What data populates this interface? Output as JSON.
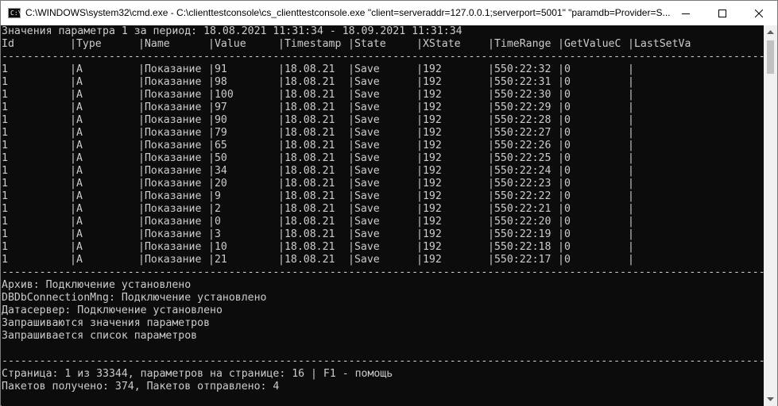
{
  "window": {
    "title": "C:\\WINDOWS\\system32\\cmd.exe - C:\\clienttestconsole\\cs_clienttestconsole.exe  \"client=serveraddr=127.0.0.1;serverport=5001\" \"paramdb=Provider=S..."
  },
  "console": {
    "heading": "Значения параметра 1 за период: 18.08.2021 11:31:34 - 18.09.2021 11:31:34",
    "columns": [
      "Id",
      "|Type",
      "|Name",
      "|Value",
      "|Timestamp",
      "|State",
      "|XState",
      "|TimeRange",
      "|GetValueC",
      "|LastSetVa"
    ],
    "separator": "--------------------------------------------------------------------------------------------------------------------------------",
    "rows": [
      [
        "1",
        "|A",
        "|Показание",
        "|91",
        "|18.08.21",
        "|Save",
        "|192",
        "|550:22:32",
        "|0",
        "|"
      ],
      [
        "1",
        "|A",
        "|Показание",
        "|98",
        "|18.08.21",
        "|Save",
        "|192",
        "|550:22:31",
        "|0",
        "|"
      ],
      [
        "1",
        "|A",
        "|Показание",
        "|100",
        "|18.08.21",
        "|Save",
        "|192",
        "|550:22:30",
        "|0",
        "|"
      ],
      [
        "1",
        "|A",
        "|Показание",
        "|97",
        "|18.08.21",
        "|Save",
        "|192",
        "|550:22:29",
        "|0",
        "|"
      ],
      [
        "1",
        "|A",
        "|Показание",
        "|90",
        "|18.08.21",
        "|Save",
        "|192",
        "|550:22:28",
        "|0",
        "|"
      ],
      [
        "1",
        "|A",
        "|Показание",
        "|79",
        "|18.08.21",
        "|Save",
        "|192",
        "|550:22:27",
        "|0",
        "|"
      ],
      [
        "1",
        "|A",
        "|Показание",
        "|65",
        "|18.08.21",
        "|Save",
        "|192",
        "|550:22:26",
        "|0",
        "|"
      ],
      [
        "1",
        "|A",
        "|Показание",
        "|50",
        "|18.08.21",
        "|Save",
        "|192",
        "|550:22:25",
        "|0",
        "|"
      ],
      [
        "1",
        "|A",
        "|Показание",
        "|34",
        "|18.08.21",
        "|Save",
        "|192",
        "|550:22:24",
        "|0",
        "|"
      ],
      [
        "1",
        "|A",
        "|Показание",
        "|20",
        "|18.08.21",
        "|Save",
        "|192",
        "|550:22:23",
        "|0",
        "|"
      ],
      [
        "1",
        "|A",
        "|Показание",
        "|9",
        "|18.08.21",
        "|Save",
        "|192",
        "|550:22:22",
        "|0",
        "|"
      ],
      [
        "1",
        "|A",
        "|Показание",
        "|2",
        "|18.08.21",
        "|Save",
        "|192",
        "|550:22:21",
        "|0",
        "|"
      ],
      [
        "1",
        "|A",
        "|Показание",
        "|0",
        "|18.08.21",
        "|Save",
        "|192",
        "|550:22:20",
        "|0",
        "|"
      ],
      [
        "1",
        "|A",
        "|Показание",
        "|3",
        "|18.08.21",
        "|Save",
        "|192",
        "|550:22:19",
        "|0",
        "|"
      ],
      [
        "1",
        "|A",
        "|Показание",
        "|10",
        "|18.08.21",
        "|Save",
        "|192",
        "|550:22:18",
        "|0",
        "|"
      ],
      [
        "1",
        "|A",
        "|Показание",
        "|21",
        "|18.08.21",
        "|Save",
        "|192",
        "|550:22:17",
        "|0",
        "|"
      ]
    ],
    "status_lines": [
      "Архив: Подключение установлено",
      "DBDbConnectionMng: Подключение установлено",
      "Датасервер: Подключение установлено",
      "Запрашиваются значения параметров",
      "Запрашивается список параметров"
    ],
    "page_info": "Страница: 1 из 33344, параметров на странице: 16 | F1 - помощь",
    "packets_info": "Пакетов получено: 374, Пакетов отправлено: 4"
  },
  "icons": {
    "app": "console-icon",
    "minimize": "minimize-icon",
    "maximize": "maximize-icon",
    "close": "close-icon",
    "scroll_up": "arrow-up-icon",
    "scroll_down": "arrow-down-icon"
  },
  "colors": {
    "console_bg": "#0c0c0c",
    "console_text": "#cccccc",
    "titlebar_bg": "#ffffff"
  }
}
